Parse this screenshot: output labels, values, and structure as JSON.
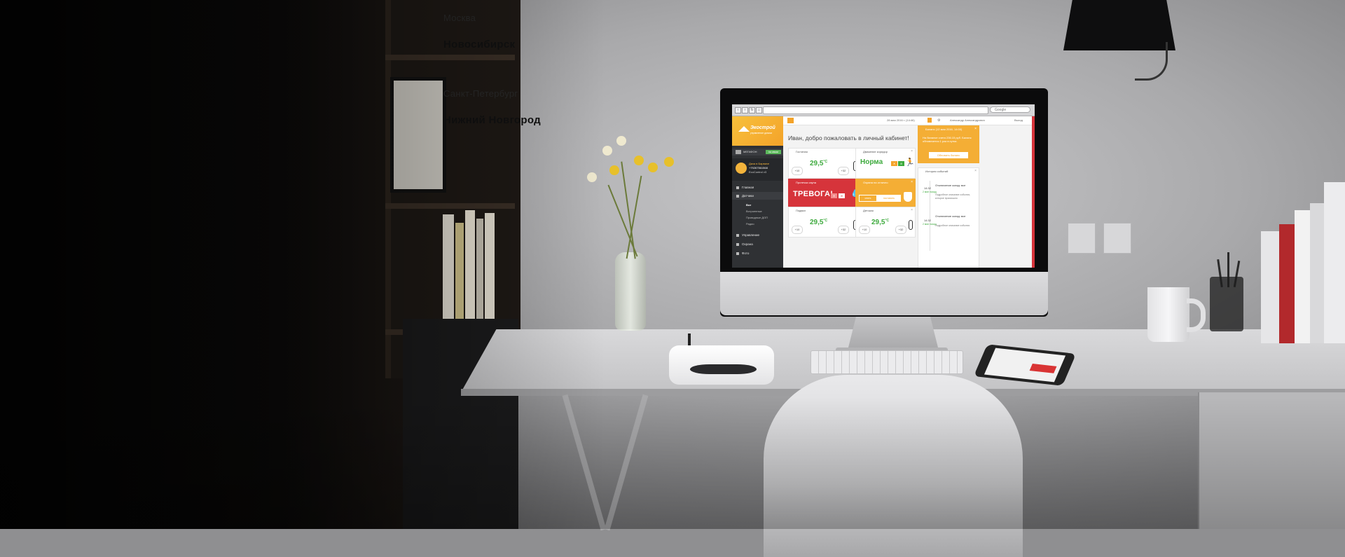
{
  "overlay_cities": {
    "c1": "Москва",
    "c2": "Новосибирск",
    "c3": "Санкт-Петербург",
    "c4": "Нижний Новгород"
  },
  "browser": {
    "search_placeholder": "Google"
  },
  "app": {
    "logo_name": "Экострой",
    "logo_tagline": "управление домом",
    "device": {
      "label": "МЕГАФОН",
      "status": "на связи"
    },
    "profile": {
      "name": "Дача в Барвихе",
      "phone": "+79267561568",
      "device": "EcoControl v3"
    },
    "sidebar": {
      "items": [
        {
          "label": "Главная"
        },
        {
          "label": "Датчики"
        },
        {
          "label": "Управление"
        },
        {
          "label": "Охрана"
        },
        {
          "label": "Фото"
        }
      ],
      "sensors_sub": [
        {
          "label": "Все"
        },
        {
          "label": "Встроенные"
        },
        {
          "label": "Проводные ДОП"
        },
        {
          "label": "Радио"
        }
      ]
    },
    "header": {
      "date": "28 мая 2016 г. (14:46)",
      "user": "Александр Александрович",
      "exit": "Выход"
    },
    "welcome": "Иван, добро пожаловать в личный кабинет!",
    "widgets": {
      "living": {
        "title": "Гостиная",
        "temp": "29,5",
        "unit": "°C",
        "min": "+10",
        "max": "+32"
      },
      "corridor": {
        "title": "Движение коридор",
        "status": "Норма",
        "b1": "✕",
        "b2": "⊘"
      },
      "leak": {
        "title": "Протечка сауна",
        "status": "ТРЕВОГА!",
        "b1": "✕",
        "b2": "⊘"
      },
      "security": {
        "title": "Охрана на отлично",
        "btn1": "снять",
        "btn2": "поставить"
      },
      "basement": {
        "title": "Подвал",
        "temp": "29,5",
        "unit": "°C",
        "min": "+10",
        "max": "+32"
      },
      "kids": {
        "title": "Детская",
        "temp": "29,5",
        "unit": "°C",
        "min": "+10",
        "max": "+32"
      },
      "balance": {
        "title": "Баланс (12 мая 2016, 14:00)",
        "text": "На балансе счета 236.15 руб. Баланс обновляется 1 раз в сутки.",
        "button": "Обновить баланс"
      },
      "events": {
        "title": "История событий",
        "items": [
          {
            "time": "14:32",
            "ago": "2 мин назад",
            "title": "Отключение склад: все",
            "desc": "Подробное описание события, которое произошло"
          },
          {
            "time": "14:32",
            "ago": "2 мин назад",
            "title": "Отключение склад: все",
            "desc": "Подробное описание события"
          }
        ]
      }
    }
  },
  "colors": {
    "accent": "#f4a32a",
    "alarm": "#d6343b",
    "ok": "#3daa3d",
    "sidebar": "#2f3134"
  }
}
